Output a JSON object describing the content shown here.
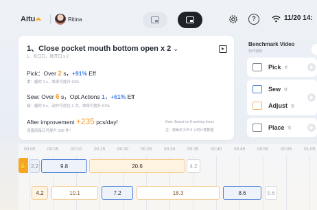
{
  "header": {
    "logo_text": "Aitu",
    "user_name": "Ritina",
    "time": "11/20 14:"
  },
  "step": {
    "title": "1、Close pocket mouth bottom open x 2",
    "subtitle": "1、合口口、底开口 x 2",
    "pick": {
      "prefix": "Pick：Over ",
      "num": "2",
      "unit": " s，",
      "pct": "+91%",
      "eff": " Eff",
      "sub": "拿：超时 2 s，效率可提升 91%"
    },
    "sew": {
      "prefix": "Sew: Over ",
      "num": "6",
      "mid": " s，Opt.Actions ",
      "actions": "1",
      "sep": "，",
      "pct": "+61%",
      "eff": " Eff",
      "sub": "缝：超时 6 s，动作可优化 1 次，效率可提升 61%"
    },
    "improvement": {
      "prefix": "After improvement ",
      "value": "+235",
      "suffix": " pcs/day!",
      "sub": "改善后每日可提升 235 件！",
      "note": "Note: Based on 8 working hours",
      "note_sub": "注：按每天工作 8 小时计算数据"
    }
  },
  "benchmark": {
    "title": "Benchmark Video",
    "subtitle": "标杆视频",
    "items": [
      {
        "label": "Pick",
        "tag": "拿",
        "icon": "hand-pick-icon"
      },
      {
        "label": "Sew",
        "tag": "缝",
        "icon": "sew-icon"
      },
      {
        "label": "Adjust",
        "tag": "整",
        "icon": "adjust-icon"
      },
      {
        "label": "Place",
        "tag": "放",
        "icon": "place-icon"
      }
    ]
  },
  "timeline": {
    "ticks": [
      "00:00",
      "00:05",
      "00:10",
      "00:15",
      "00:20",
      "00:25",
      "00:30",
      "00:35",
      "00:40",
      "00:45",
      "00:50",
      "00:55",
      "01:00"
    ],
    "row1": [
      "2.2",
      "9.8",
      "20.6",
      "4.2"
    ],
    "row2": [
      "4.2",
      "10.1",
      "7.2",
      "18.3",
      "8.6",
      "5.6"
    ]
  },
  "colors": {
    "accent_orange": "#f29a2e",
    "accent_blue": "#3f7ee8"
  }
}
